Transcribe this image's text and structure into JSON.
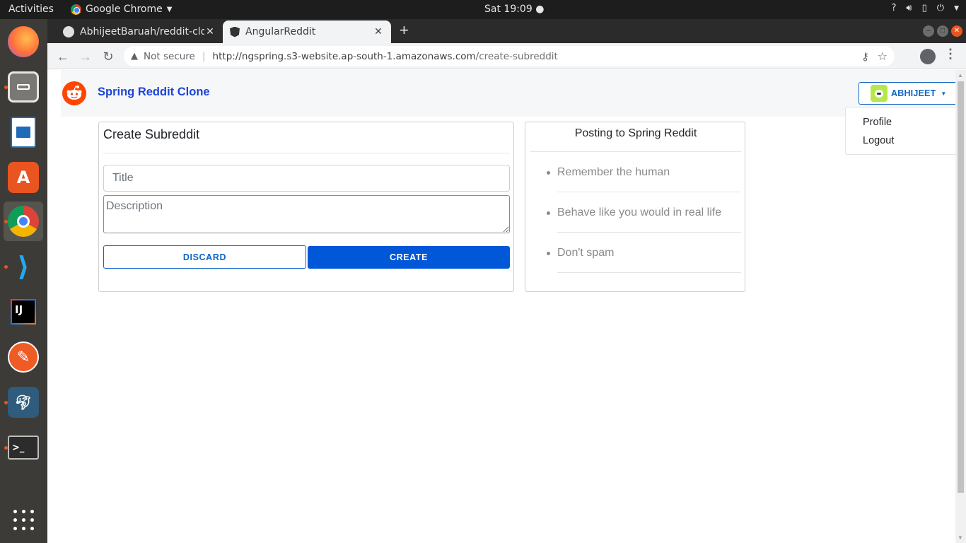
{
  "system": {
    "activities_label": "Activities",
    "app_menu_label": "Google Chrome",
    "clock": "Sat 19:09"
  },
  "browser": {
    "tabs": [
      {
        "title": "AbhijeetBaruah/reddit-clone",
        "favicon": "github-icon",
        "active": false
      },
      {
        "title": "AngularReddit",
        "favicon": "angular-icon",
        "active": true
      }
    ],
    "security_label": "Not secure",
    "url_host": "http://ngspring.s3-website.ap-south-1.amazonaws.com",
    "url_path": "/create-subreddit"
  },
  "app": {
    "brand": "Spring Reddit Clone",
    "user": {
      "name": "ABHIJEET",
      "menu": [
        "Profile",
        "Logout"
      ]
    },
    "create_form": {
      "heading": "Create Subreddit",
      "title_placeholder": "Title",
      "title_value": "",
      "description_placeholder": "Description",
      "description_value": "",
      "discard_label": "DISCARD",
      "create_label": "CREATE"
    },
    "rules": {
      "heading": "Posting to Spring Reddit",
      "items": [
        "Remember the human",
        "Behave like you would in real life",
        "Don't spam"
      ]
    }
  },
  "colors": {
    "brand_blue": "#1c44d6",
    "primary": "#0057d8",
    "reddit_orange": "#ff4500"
  }
}
